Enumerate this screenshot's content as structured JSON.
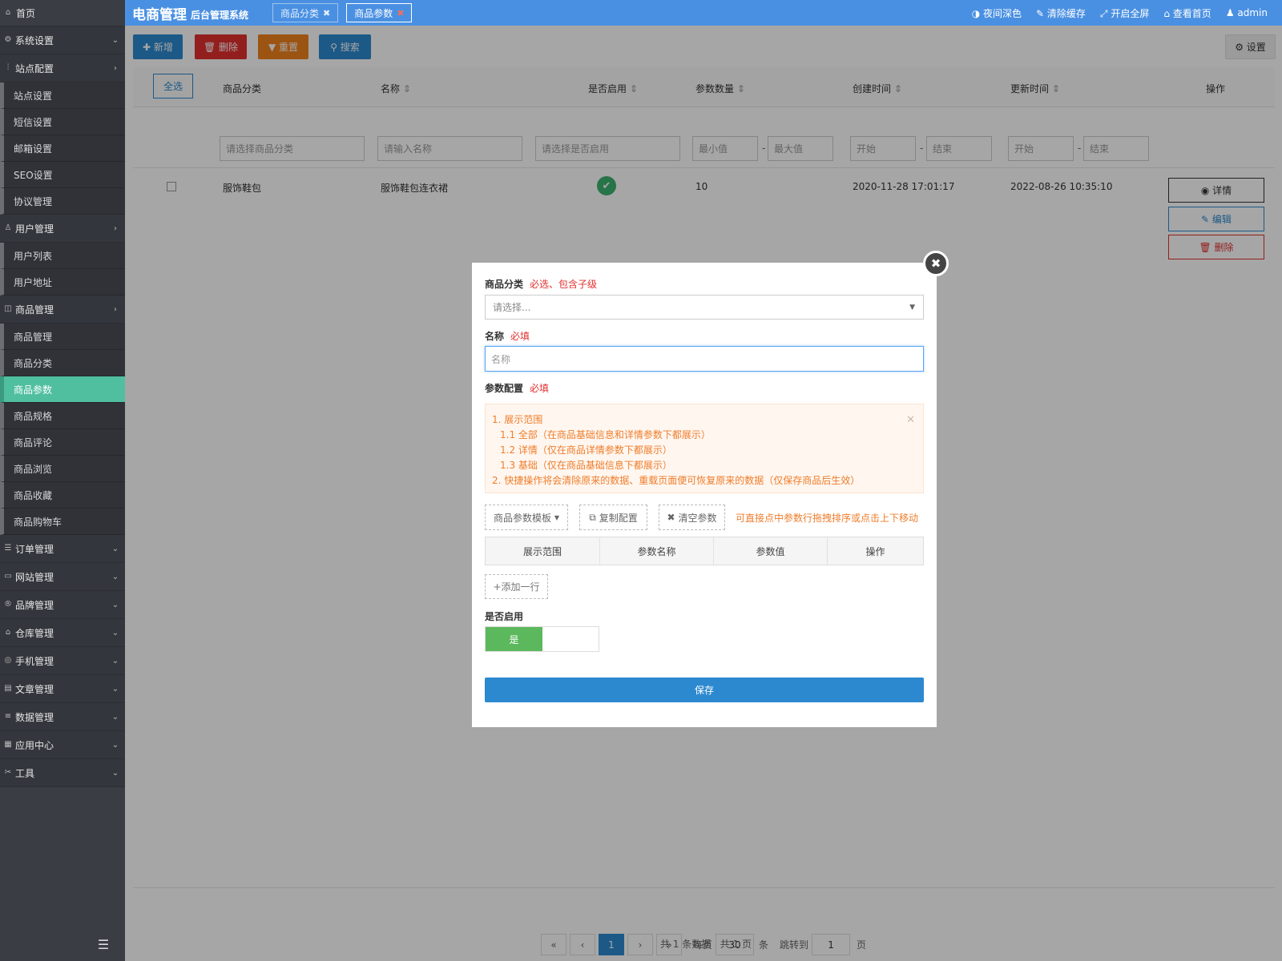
{
  "sidebar": {
    "home": "首页",
    "groups": {
      "system": "系统设置",
      "site_config": "站点配置",
      "user_mgmt": "用户管理",
      "goods_mgmt": "商品管理",
      "order_mgmt": "订单管理",
      "website_mgmt": "网站管理",
      "brand_mgmt": "品牌管理",
      "warehouse_mgmt": "仓库管理",
      "mobile_mgmt": "手机管理",
      "article_mgmt": "文章管理",
      "data_mgmt": "数据管理",
      "app_center": "应用中心",
      "tools": "工具"
    },
    "site_items": [
      "站点设置",
      "短信设置",
      "邮箱设置",
      "SEO设置",
      "协议管理"
    ],
    "user_items": [
      "用户列表",
      "用户地址"
    ],
    "goods_items": [
      "商品管理",
      "商品分类",
      "商品参数",
      "商品规格",
      "商品评论",
      "商品浏览",
      "商品收藏",
      "商品购物车"
    ]
  },
  "topbar": {
    "brand": "电商管理",
    "brand_sub": "后台管理系统",
    "tabs": [
      "商品分类",
      "商品参数"
    ],
    "night": "夜间深色",
    "clear_cache": "清除缓存",
    "fullscreen": "开启全屏",
    "view_home": "查看首页",
    "user": "admin"
  },
  "toolbar": {
    "add": "新增",
    "delete": "删除",
    "reset": "重置",
    "search": "搜索",
    "settings": "设置"
  },
  "table": {
    "select_all": "全选",
    "headers": {
      "category": "商品分类",
      "name": "名称",
      "enabled": "是否启用",
      "param_count": "参数数量",
      "created": "创建时间",
      "updated": "更新时间",
      "ops": "操作"
    },
    "filters": {
      "category": "请选择商品分类",
      "name": "请输入名称",
      "enabled": "请选择是否启用",
      "min": "最小值",
      "max": "最大值",
      "start": "开始",
      "end": "结束",
      "dash": "-"
    },
    "row": {
      "category": "服饰鞋包",
      "name": "服饰鞋包连衣裙",
      "param_count": "10",
      "created": "2020-11-28 17:01:17",
      "updated": "2022-08-26 10:35:10"
    },
    "ops": {
      "detail": "详情",
      "edit": "编辑",
      "delete": "删除"
    }
  },
  "pagination": {
    "first": "«",
    "prev": "‹",
    "current": "1",
    "next": "›",
    "last": "»",
    "per_page_label": "每页",
    "per_page": "30",
    "unit": "条",
    "jump_label": "跳转到",
    "jump_value": "1",
    "page_unit": "页",
    "summary": "共 1 条数据   共 1 页"
  },
  "modal": {
    "category_label": "商品分类",
    "category_req": "必选、包含子级",
    "category_placeholder": "请选择...",
    "name_label": "名称",
    "name_req": "必填",
    "name_placeholder": "名称",
    "param_label": "参数配置",
    "param_req": "必填",
    "notice": [
      "1. 展示范围",
      "1.1 全部（在商品基础信息和详情参数下都展示）",
      "1.2 详情（仅在商品详情参数下都展示）",
      "1.3 基础（仅在商品基础信息下都展示）",
      "2. 快捷操作将会清除原来的数据、重载页面便可恢复原来的数据（仅保存商品后生效）"
    ],
    "template_btn": "商品参数模板",
    "copy_btn": "复制配置",
    "clear_btn": "清空参数",
    "hint": "可直接点中参数行拖拽排序或点击上下移动",
    "param_table_headers": [
      "展示范围",
      "参数名称",
      "参数值",
      "操作"
    ],
    "add_row": "+添加一行",
    "enabled_label": "是否启用",
    "enabled_value": "是",
    "save": "保存"
  },
  "colors": {
    "topbar": "#4a90e2",
    "sidebar": "#3a3d44",
    "active_menu": "#50bfa0",
    "add_btn": "#2c89cf",
    "delete_btn": "#e0302e",
    "reset_btn": "#f0821e",
    "search_btn": "#2c89cf",
    "save_btn": "#2c89cf",
    "notice_text": "#ef7d2b",
    "switch_on": "#5cb85c"
  }
}
